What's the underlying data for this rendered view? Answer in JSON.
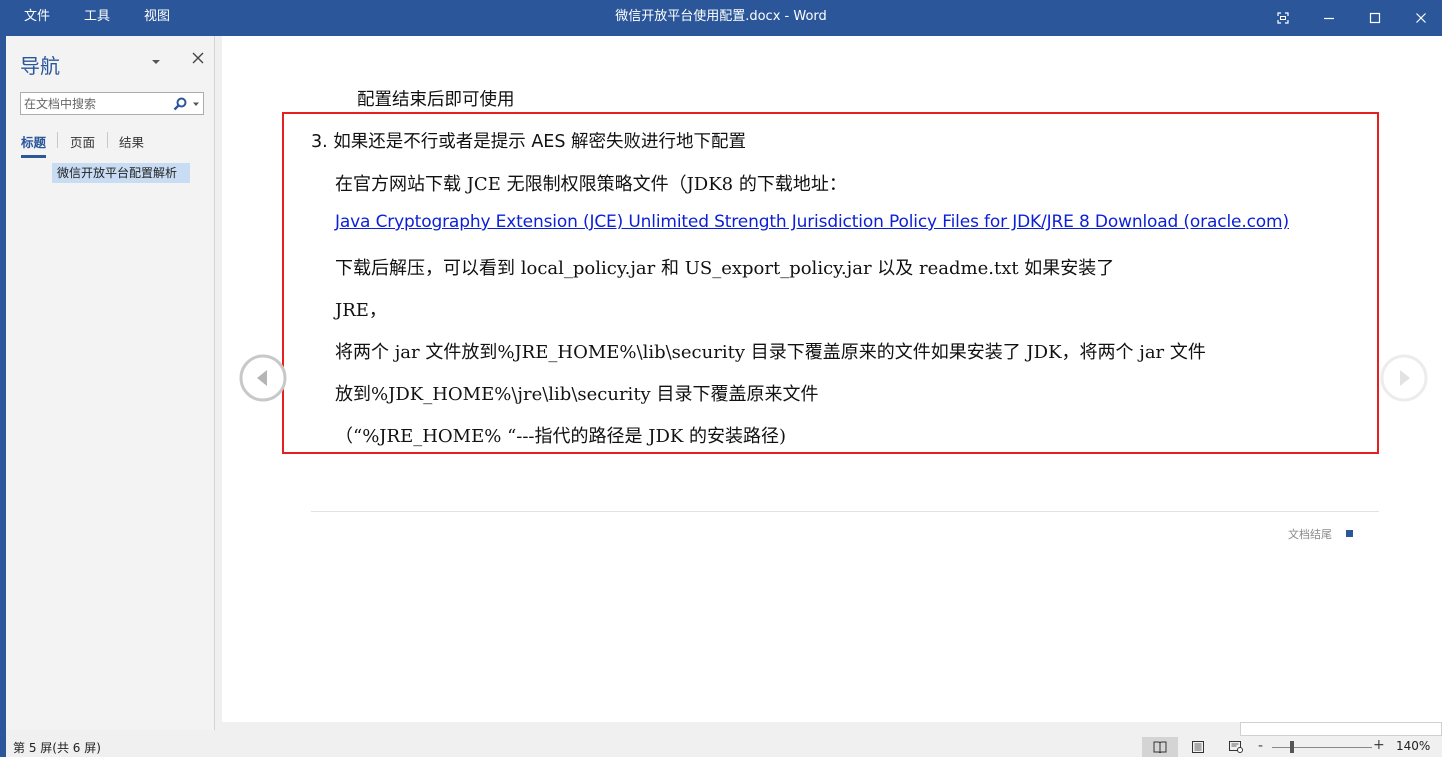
{
  "titlebar": {
    "menus": [
      "文件",
      "工具",
      "视图"
    ],
    "document_title": "微信开放平台使用配置.docx  -  Word"
  },
  "nav": {
    "title": "导航",
    "search_placeholder": "在文档中搜索",
    "tabs": [
      "标题",
      "页面",
      "结果"
    ],
    "active_tab": "标题",
    "headings": [
      "微信开放平台配置解析"
    ]
  },
  "document": {
    "pre_text": "配置结束后即可使用",
    "lines": [
      "3. 如果还是不行或者是提示 AES 解密失败进行地下配置",
      "在官方网站下载 JCE 无限制权限策略文件（JDK8 的下载地址：",
      "Java Cryptography Extension (JCE) Unlimited Strength Jurisdiction Policy Files for JDK/JRE 8 Download (oracle.com)",
      "下载后解压，可以看到 local_policy.jar 和 US_export_policy.jar 以及 readme.txt   如果安装了",
      "JRE，",
      "将两个 jar 文件放到%JRE_HOME%\\lib\\security 目录下覆盖原来的文件如果安装了 JDK，将两个 jar 文件",
      "放到%JDK_HOME%\\jre\\lib\\security 目录下覆盖原来文件",
      "（“%JRE_HOME% “---指代的路径是 JDK 的安装路径)"
    ],
    "end_label": "文档结尾",
    "highlight_color": "#e62020",
    "link_color": "#0b1fd8"
  },
  "status": {
    "page_info": "第 5 屏(共 6 屏)",
    "zoom_minus": "-",
    "zoom_plus": "+",
    "zoom": "140%"
  },
  "colors": {
    "accent": "#2b579a"
  }
}
